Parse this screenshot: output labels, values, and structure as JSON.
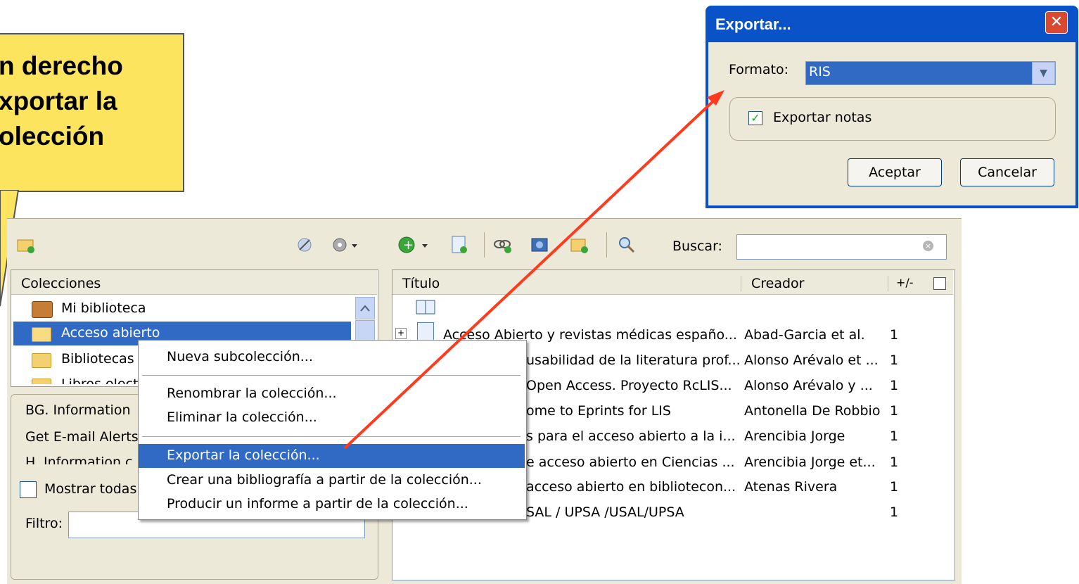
{
  "callout": {
    "lines": [
      "n derecho",
      "xportar la",
      "olección"
    ],
    "bg_color": "#fce45f"
  },
  "toolbar": {
    "search_label": "Buscar:",
    "icons": [
      "new-collection-icon",
      "link-icon",
      "gear-icon",
      "add-item-icon",
      "new-note-icon",
      "link-doi-icon",
      "snapshot-icon",
      "attach-icon",
      "advanced-search-icon",
      "clear-search-icon"
    ]
  },
  "collections_pane": {
    "header": "Colecciones",
    "items": [
      {
        "label": "Mi biblioteca",
        "icon": "library-icon"
      },
      {
        "label": "Acceso abierto",
        "icon": "folder-icon",
        "selected": true
      },
      {
        "label": "Bibliotecas",
        "icon": "folder-icon"
      },
      {
        "label": "Libros electr",
        "icon": "folder-icon"
      }
    ]
  },
  "tags_pane": {
    "items": [
      "BG. Information",
      "Get E-mail Alerts",
      "H. Information c"
    ],
    "show_all_label": "Mostrar todas",
    "filter_label": "Filtro:"
  },
  "items_pane": {
    "headers": {
      "title": "Título",
      "creator": "Creador",
      "extra": "+/-"
    },
    "rows": [
      {
        "title": "Acceso Abierto y revistas médicas españo...",
        "creator": "Abad-Garcia et al.",
        "count": "1"
      },
      {
        "title": "usabilidad de la literatura prof...",
        "creator": "Alonso Arévalo et ...",
        "count": "1"
      },
      {
        "title": "Open Access. Proyecto RcLIS...",
        "creator": "Alonso Arévalo y ...",
        "count": "1"
      },
      {
        "title": "ome to Eprints for LIS",
        "creator": "Antonella De Robbio",
        "count": "1"
      },
      {
        "title": "s para el acceso abierto a la i...",
        "creator": "Arencibia Jorge",
        "count": "1"
      },
      {
        "title": "e acceso abierto en Ciencias ...",
        "creator": "Arencibia Jorge et...",
        "count": "1"
      },
      {
        "title": "acceso abierto en bibliotecon...",
        "creator": "Atenas Rivera",
        "count": "1"
      },
      {
        "title": "SAL / UPSA /USAL/UPSA",
        "creator": "",
        "count": "1"
      }
    ]
  },
  "context_menu": {
    "items": [
      {
        "label": "Nueva subcolección..."
      },
      {
        "label": "Renombrar la colección..."
      },
      {
        "label": "Eliminar la colección..."
      },
      {
        "label": "Exportar la colección...",
        "highlighted": true
      },
      {
        "label": "Crear una bibliografía a partir de la colección..."
      },
      {
        "label": "Producir un informe a partir de la colección..."
      }
    ]
  },
  "dialog": {
    "title": "Exportar...",
    "format_label": "Formato:",
    "format_value": "RIS",
    "notes_label": "Exportar notas",
    "notes_checked": true,
    "accept": "Aceptar",
    "cancel": "Cancelar",
    "title_bar_color": "#0a52c8"
  },
  "arrow_color": "#ff3b1f"
}
